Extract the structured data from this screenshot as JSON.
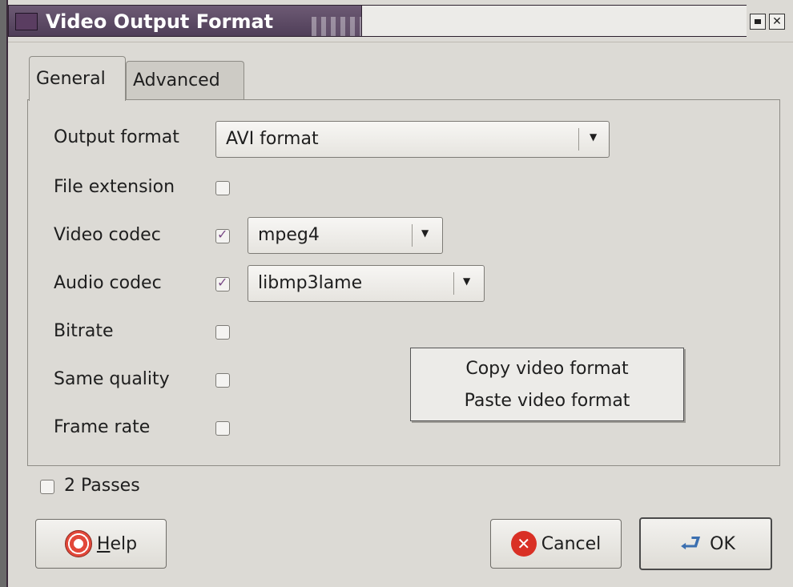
{
  "window": {
    "title": "Video Output Format"
  },
  "tabs": [
    {
      "label": "General",
      "active": true
    },
    {
      "label": "Advanced",
      "active": false
    }
  ],
  "form": {
    "output_format": {
      "label": "Output format",
      "value": "AVI format"
    },
    "file_extension": {
      "label": "File extension",
      "checked": false
    },
    "video_codec": {
      "label": "Video codec",
      "checked": true,
      "value": "mpeg4"
    },
    "audio_codec": {
      "label": "Audio codec",
      "checked": true,
      "value": "libmp3lame"
    },
    "bitrate": {
      "label": "Bitrate",
      "checked": false
    },
    "same_quality": {
      "label": "Same quality",
      "checked": false
    },
    "frame_rate": {
      "label": "Frame rate",
      "checked": false
    }
  },
  "context_menu": {
    "items": [
      "Copy video format",
      "Paste video format"
    ]
  },
  "two_passes": {
    "label": "2 Passes",
    "checked": false
  },
  "buttons": {
    "help_prefix": "H",
    "help_rest": "elp",
    "cancel": "Cancel",
    "ok": "OK"
  },
  "icons": {
    "help": "lifebuoy-icon",
    "cancel": "cancel-x-icon",
    "ok": "return-arrow-icon",
    "dropdown": "dropdown-arrow-icon"
  },
  "colors": {
    "titlebar": "#5a4763",
    "window_bg": "#dcdad5",
    "checkmark": "#7a4a86",
    "cancel_icon": "#d93025",
    "ok_icon": "#3b6fb0"
  }
}
